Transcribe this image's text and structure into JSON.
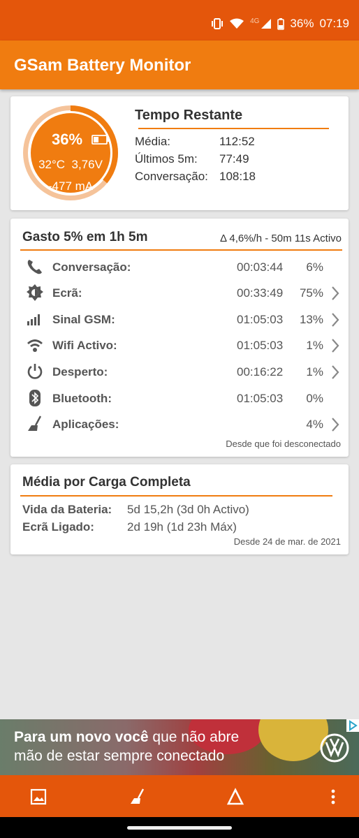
{
  "status_bar": {
    "network": "4G",
    "battery_text": "36%",
    "time": "07:19",
    "icons": [
      "vibrate-icon",
      "wifi-icon",
      "cell-signal-icon",
      "battery-icon"
    ]
  },
  "app": {
    "title": "GSam Battery Monitor"
  },
  "gauge": {
    "percent": "36%",
    "level": 0.36,
    "temp_volt": "32°C  3,76V",
    "current": "-477 mA",
    "accent": "#f07c10"
  },
  "time_remaining": {
    "title": "Tempo Restante",
    "rows": [
      {
        "label": "Média:",
        "value": "112:52"
      },
      {
        "label": "Últimos 5m:",
        "value": "77:49"
      },
      {
        "label": "Conversação:",
        "value": "108:18"
      }
    ]
  },
  "usage": {
    "title": "Gasto 5% em 1h 5m",
    "delta": "Δ 4,6%/h - 50m 11s Activo",
    "rows": [
      {
        "label": "Conversação:",
        "time": "00:03:44",
        "percent": "6%",
        "icon": "phone-icon"
      },
      {
        "label": "Ecrã:",
        "time": "00:33:49",
        "percent": "75%",
        "icon": "brightness-icon"
      },
      {
        "label": "Sinal GSM:",
        "time": "01:05:03",
        "percent": "13%",
        "icon": "signal-bars-icon"
      },
      {
        "label": "Wifi Activo:",
        "time": "01:05:03",
        "percent": "1%",
        "icon": "wifi-icon"
      },
      {
        "label": "Desperto:",
        "time": "00:16:22",
        "percent": "1%",
        "icon": "power-icon"
      },
      {
        "label": "Bluetooth:",
        "time": "01:05:03",
        "percent": "0%",
        "icon": "bluetooth-icon"
      },
      {
        "label": "Aplicações:",
        "time": "",
        "percent": "4%",
        "icon": "broom-icon"
      }
    ],
    "footer": "Desde que foi desconectado"
  },
  "full_charge": {
    "title": "Média por Carga Completa",
    "rows": [
      {
        "label": "Vida da Bateria:",
        "value": "5d 15,2h (3d 0h Activo)"
      },
      {
        "label": "Ecrã Ligado:",
        "value": "2d 19h (1d 23h Máx)"
      }
    ],
    "footer": "Desde 24 de mar. de 2021"
  },
  "ad": {
    "line1_bold": "Para um novo você",
    "line1_rest": " que não abre",
    "line2": "mão de estar sempre conectado"
  },
  "bottom_bar": {
    "icons": [
      "image-icon",
      "broom-icon",
      "delta-icon",
      "more-vert-icon"
    ]
  }
}
